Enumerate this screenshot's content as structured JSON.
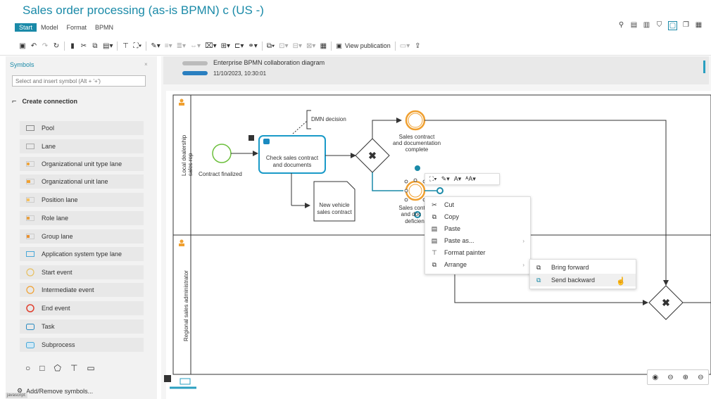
{
  "app": {
    "title": "Sales order processing (as-is BPMN) c (US -)"
  },
  "menu": [
    "Start",
    "Model",
    "Format",
    "BPMN"
  ],
  "toolbar": {
    "view_publication": "View publication"
  },
  "view_icons": [
    "search-icon",
    "properties-icon",
    "chart-icon",
    "shield-icon",
    "frame-icon",
    "clone-icon",
    "table-icon"
  ],
  "symbols_panel": {
    "title": "Symbols",
    "close": "×",
    "search_placeholder": "Select and insert symbol (Alt + '+')",
    "create_connection": "Create connection",
    "items": [
      "Pool",
      "Lane",
      "Organizational unit type lane",
      "Organizational unit lane",
      "Position lane",
      "Role lane",
      "Group lane",
      "Application system type lane",
      "Start event",
      "Intermediate event",
      "End event",
      "Task",
      "Subprocess"
    ],
    "add_remove": "Add/Remove symbols...",
    "status": "javascript:"
  },
  "diagram_header": {
    "title": "Enterprise BPMN collaboration diagram",
    "date": "11/10/2023, 10:30:01"
  },
  "diagram": {
    "lane1_label": "Local dealership sales rep",
    "lane2_label": "Regional sales administrator",
    "start_event": "Contract finalized",
    "task": "Check sales contract and documents",
    "dmn": "DMN decision",
    "doc": "New vehicle sales contract",
    "end1": "Sales contract and documentation complete",
    "end2": "Sales cont and doc      deficien"
  },
  "context_menu": {
    "items": [
      "Cut",
      "Copy",
      "Paste",
      "Paste as...",
      "Format painter",
      "Arrange"
    ],
    "submenu": [
      "Bring forward",
      "Send backward"
    ]
  },
  "colors": {
    "accent": "#1a8aa8",
    "event": "#f0a030",
    "start": "#6cbf3c"
  }
}
